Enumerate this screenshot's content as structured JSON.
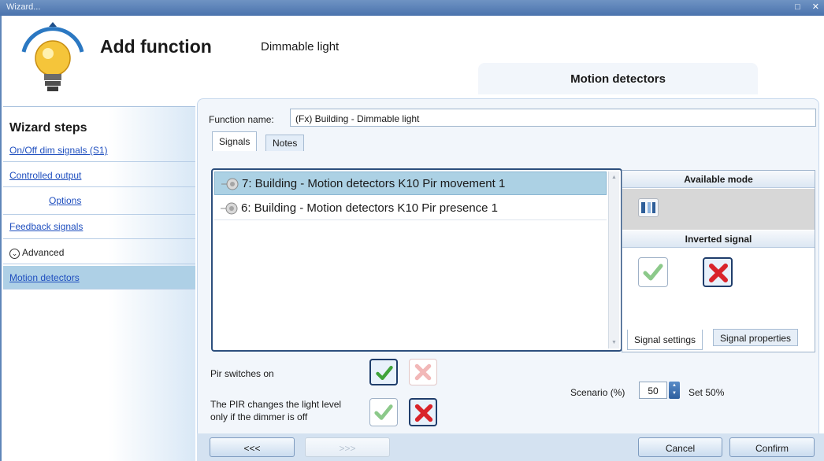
{
  "window": {
    "title": "Wizard...",
    "controls": "□ ✕"
  },
  "header": {
    "title": "Add function",
    "subtitle": "Dimmable light",
    "section_tab": "Motion detectors"
  },
  "sidebar": {
    "title": "Wizard steps",
    "steps": [
      {
        "label": "On/Off dim signals (S1)"
      },
      {
        "label": "Controlled output"
      },
      {
        "label": "Options"
      },
      {
        "label": "Feedback signals"
      },
      {
        "label": "Advanced"
      },
      {
        "label": "Motion detectors"
      }
    ]
  },
  "function": {
    "name_label": "Function name:",
    "name_value": "(Fx) Building - Dimmable light"
  },
  "tabs": [
    {
      "label": "Signals"
    },
    {
      "label": "Notes"
    }
  ],
  "signals": [
    {
      "label": "7: Building - Motion detectors K10 Pir movement 1",
      "selected": true
    },
    {
      "label": "6: Building - Motion detectors K10 Pir presence 1",
      "selected": false
    }
  ],
  "mode_panel": {
    "available_mode_title": "Available mode",
    "inverted_signal_title": "Inverted signal",
    "tabs": [
      {
        "label": "Signal settings"
      },
      {
        "label": "Signal properties"
      }
    ]
  },
  "options": {
    "pir_switches_on": "Pir switches on",
    "pir_changes_line1": "The PIR changes the light level",
    "pir_changes_line2": "only if the dimmer is off"
  },
  "scenario": {
    "label": "Scenario (%)",
    "value": "50",
    "set_text": "Set 50%"
  },
  "footer": {
    "back": "<<<",
    "next": ">>>",
    "cancel": "Cancel",
    "confirm": "Confirm"
  },
  "colors": {
    "accent": "#4a73ad",
    "selected_row": "#acd1e4",
    "check_green": "#3fa33a",
    "cross_red": "#d9232a"
  }
}
